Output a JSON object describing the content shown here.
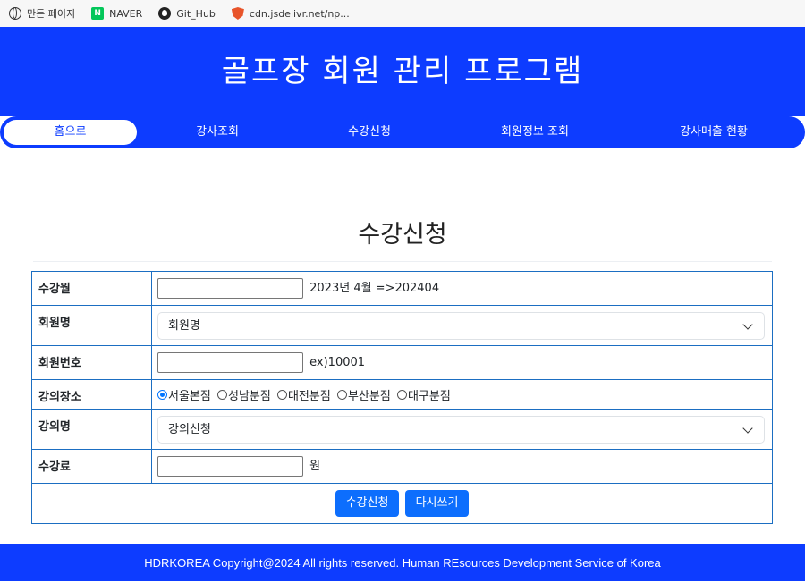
{
  "bookmarks": [
    {
      "label": "만든 페이지",
      "icon": "globe-icon"
    },
    {
      "label": "NAVER",
      "icon": "naver-icon"
    },
    {
      "label": "Git_Hub",
      "icon": "github-icon"
    },
    {
      "label": "cdn.jsdelivr.net/np...",
      "icon": "shield-icon"
    }
  ],
  "header": {
    "title": "골프장 회원 관리 프로그램"
  },
  "nav": {
    "items": [
      {
        "label": "홈으로",
        "active": true
      },
      {
        "label": "강사조회"
      },
      {
        "label": "수강신청"
      },
      {
        "label": "회원정보 조회"
      },
      {
        "label": "강사매출 현황"
      }
    ]
  },
  "page": {
    "title": "수강신청"
  },
  "form": {
    "month": {
      "label": "수강월",
      "value": "",
      "hint": "2023년 4월 =>202404"
    },
    "member_name": {
      "label": "회원명",
      "selected": "회원명"
    },
    "member_no": {
      "label": "회원번호",
      "value": "",
      "hint": "ex)10001"
    },
    "location": {
      "label": "강의장소",
      "options": [
        "서울본점",
        "성남분점",
        "대전분점",
        "부산분점",
        "대구분점"
      ],
      "selected": "서울본점"
    },
    "class_name": {
      "label": "강의명",
      "selected": "강의신청"
    },
    "fee": {
      "label": "수강료",
      "value": "",
      "unit": "원"
    },
    "submit_label": "수강신청",
    "reset_label": "다시쓰기"
  },
  "footer": {
    "text": "HDRKOREA Copyright@2024 All rights reserved. Human REsources Development Service of Korea"
  },
  "colors": {
    "primary": "#0d3cff",
    "button": "#0d6efd",
    "table_border": "#1b6ec2"
  }
}
